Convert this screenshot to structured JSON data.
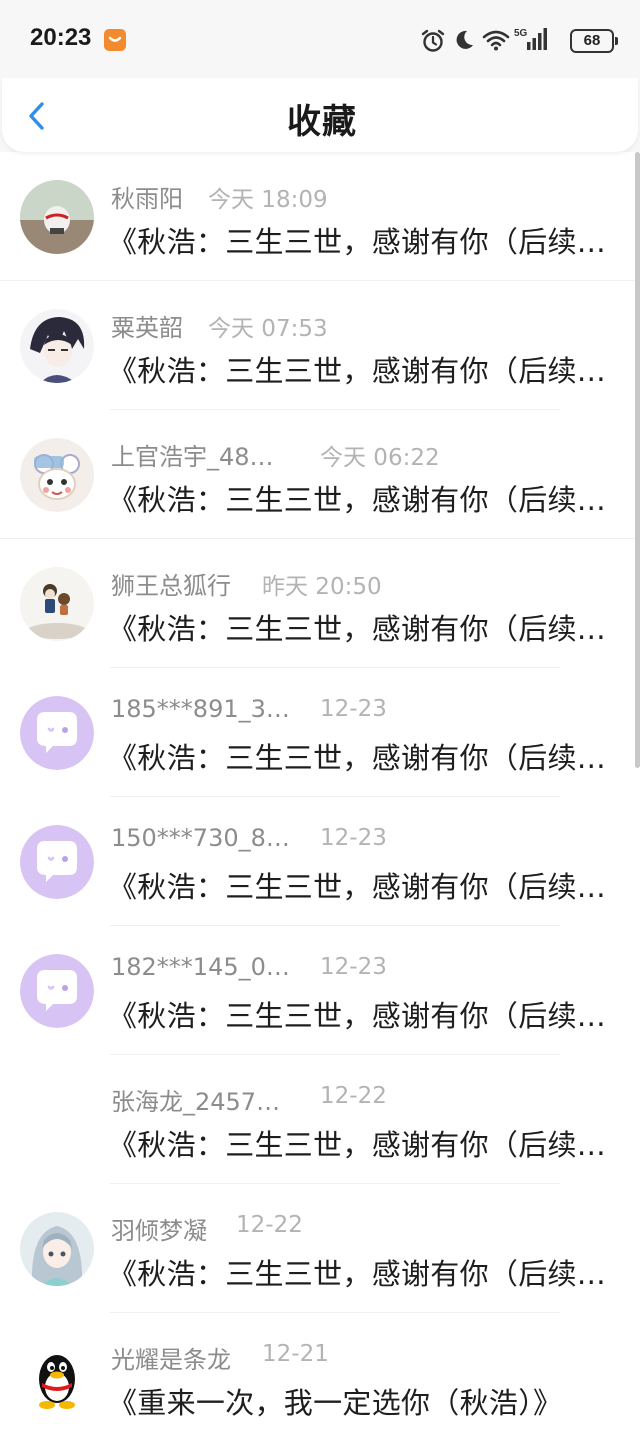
{
  "status_bar": {
    "time": "20:23",
    "battery": "68",
    "network": "5G"
  },
  "header": {
    "title": "收藏"
  },
  "items": [
    {
      "name": "秋雨阳",
      "time": "今天 18:09",
      "title": "《秋浩：三生三世，感谢有你（后续…",
      "avatar": "photo-cat-mask"
    },
    {
      "name": "粟英韶",
      "time": "今天 07:53",
      "title": "《秋浩：三生三世，感谢有你（后续…",
      "avatar": "anime-boy"
    },
    {
      "name": "上官浩宇_48…",
      "time": "今天 06:22",
      "title": "《秋浩：三生三世，感谢有你（后续…",
      "avatar": "cartoon-sheep"
    },
    {
      "name": "狮王总狐行",
      "time": "昨天 20:50",
      "title": "《秋浩：三生三世，感谢有你（后续…",
      "avatar": "anime-figure"
    },
    {
      "name": "185***891_3…",
      "time": "12-23",
      "title": "《秋浩：三生三世，感谢有你（后续…",
      "avatar": "default-chat"
    },
    {
      "name": "150***730_8…",
      "time": "12-23",
      "title": "《秋浩：三生三世，感谢有你（后续…",
      "avatar": "default-chat"
    },
    {
      "name": "182***145_0…",
      "time": "12-23",
      "title": "《秋浩：三生三世，感谢有你（后续…",
      "avatar": "default-chat"
    },
    {
      "name": "张海龙_2457…",
      "time": "12-22",
      "title": "《秋浩：三生三世，感谢有你（后续…",
      "avatar": "none"
    },
    {
      "name": "羽倾梦凝",
      "time": "12-22",
      "title": "《秋浩：三生三世，感谢有你（后续…",
      "avatar": "anime-girl"
    },
    {
      "name": "光耀是条龙",
      "time": "12-21",
      "title": "《重来一次，我一定选你（秋浩）》",
      "avatar": "qq-penguin"
    }
  ],
  "colors": {
    "accent": "#2f8fe8",
    "default_avatar": "#d7c4f5"
  }
}
